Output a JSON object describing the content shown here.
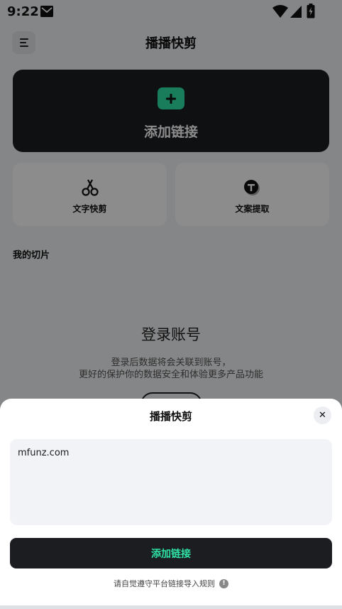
{
  "status_bar": {
    "time": "9:22",
    "icons": [
      "mail-icon",
      "wifi-icon",
      "signal-icon",
      "battery-charging-icon"
    ]
  },
  "header": {
    "title": "播播快剪",
    "menu_icon": "menu-icon"
  },
  "hero": {
    "label": "添加链接",
    "icon": "plus-icon",
    "accent_color": "#2fe2a5"
  },
  "tools": [
    {
      "label": "文字快剪",
      "icon": "scissors-icon"
    },
    {
      "label": "文案提取",
      "icon": "text-extract-icon"
    }
  ],
  "section": {
    "title": "我的切片"
  },
  "login": {
    "title": "登录账号",
    "description_line1": "登录后数据将会关联到账号，",
    "description_line2": "更好的保护你的数据安全和体验更多产品功能"
  },
  "sheet": {
    "title": "播播快剪",
    "close_icon": "close-icon",
    "input_value": "mfunz.com",
    "add_button_label": "添加链接",
    "rules_note": "请自觉遵守平台链接导入规则",
    "info_icon": "info-icon"
  },
  "colors": {
    "accent": "#2fe2a5",
    "dark": "#1c1d21",
    "sheet_bg": "#ffffff",
    "input_bg": "#f2f3f7"
  }
}
